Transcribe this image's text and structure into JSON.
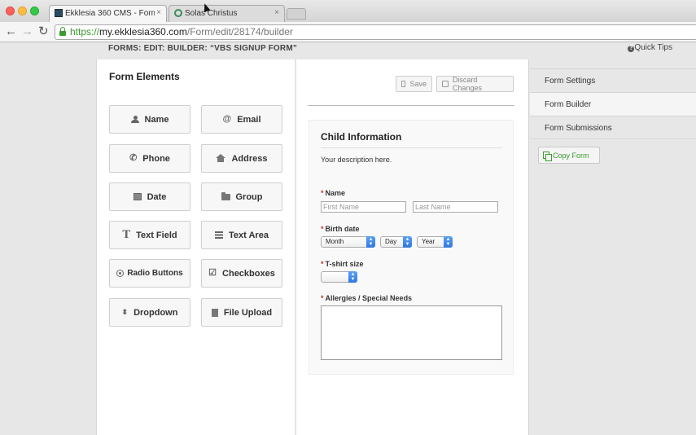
{
  "browser": {
    "tabs": [
      {
        "title": "Ekklesia 360 CMS - Forms",
        "close": "×"
      },
      {
        "title": "Solas Christus",
        "close": "×"
      }
    ],
    "url": {
      "scheme": "https://",
      "host": "my.ekklesia360.com",
      "path": "/Form/edit/28174/builder"
    },
    "nav": {
      "back": "←",
      "forward": "→",
      "reload": "↻"
    }
  },
  "header": {
    "breadcrumb": "FORMS: EDIT: BUILDER: “VBS SIGNUP FORM”",
    "quick_tips": "Quick Tips",
    "quick_tips_icon": "?"
  },
  "form_elements": {
    "title": "Form Elements",
    "items": [
      {
        "label": "Name",
        "icon": "person-icon"
      },
      {
        "label": "Email",
        "icon": "at-icon",
        "glyph": "@"
      },
      {
        "label": "Phone",
        "icon": "phone-icon",
        "glyph": "✆"
      },
      {
        "label": "Address",
        "icon": "house-icon"
      },
      {
        "label": "Date",
        "icon": "calendar-icon"
      },
      {
        "label": "Group",
        "icon": "folder-icon"
      },
      {
        "label": "Text Field",
        "icon": "text-t-icon",
        "glyph": "T"
      },
      {
        "label": "Text Area",
        "icon": "lines-icon"
      },
      {
        "label": "Radio Buttons",
        "icon": "radio-icon"
      },
      {
        "label": "Checkboxes",
        "icon": "checkbox-icon",
        "glyph": "☑"
      },
      {
        "label": "Dropdown",
        "icon": "updown-icon",
        "glyph": "⬍"
      },
      {
        "label": "File Upload",
        "icon": "file-icon"
      }
    ]
  },
  "builder": {
    "save_label": "Save",
    "discard_label": "Discard Changes",
    "form": {
      "title": "Child Information",
      "description": "Your description here.",
      "fields": {
        "name": {
          "label": "Name",
          "first_placeholder": "First Name",
          "last_placeholder": "Last Name"
        },
        "birth_date": {
          "label": "Birth date",
          "month": "Month",
          "day": "Day",
          "year": "Year"
        },
        "tshirt": {
          "label": "T-shirt size",
          "value": ""
        },
        "allergies": {
          "label": "Allergies / Special Needs"
        }
      },
      "required_mark": "*"
    }
  },
  "sidebar": {
    "items": [
      {
        "label": "Form Settings",
        "active": false
      },
      {
        "label": "Form Builder",
        "active": true
      },
      {
        "label": "Form Submissions",
        "active": false
      }
    ],
    "copy_label": "Copy Form"
  },
  "colors": {
    "accent_green": "#3a9a2d",
    "required_red": "#c0392b",
    "select_blue": "#2f78e0"
  }
}
